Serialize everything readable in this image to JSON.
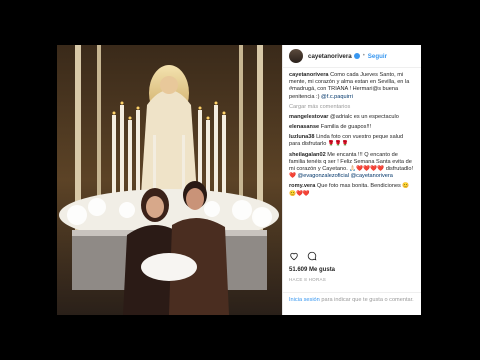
{
  "colors": {
    "link": "#3897f0",
    "heart": "#ed4956"
  },
  "post": {
    "username": "cayetanorivera",
    "follow_label": "Seguir",
    "caption_user": "cayetanorivera",
    "caption_text": "Como cada Jueves Santo, mi mente, mi corazón y alma estan en Sevilla, en la #madrugá, con TRIANA ! Hermari@s buena penitencia :)",
    "caption_mention": "@f.c.paquirri",
    "load_more": "Cargar más comentarios",
    "comments": [
      {
        "user": "mangelestovar",
        "text": "@adrialc es un espectaculo"
      },
      {
        "user": "elenasanse",
        "text": "Familia de guapos!!!"
      },
      {
        "user": "luzluna38",
        "text": "Linda foto con vuestro peque salud para disfrutarlo 🌹🌹🌹"
      },
      {
        "user": "sheilagalan02",
        "text": "Me encanta !!! Q encanto de familia tenéis q ser ! Feliz Semana Santa evita de mi corazón y Cayetano.",
        "emoji": "🙏🏻❤️❤️❤️❤️ disfrutadlo! ❤️",
        "mentions": "@evagonzalezoficial @cayetanorivera"
      },
      {
        "user": "romy.vera",
        "text": "Que foto mas bonita. Bendiciones 😊😊❤️❤️"
      }
    ],
    "likes": "51.609 Me gusta",
    "time": "HACE 8 HORAS",
    "footer_login": "Inicia sesión",
    "footer_text": "para indicar que te gusta o comentar."
  }
}
